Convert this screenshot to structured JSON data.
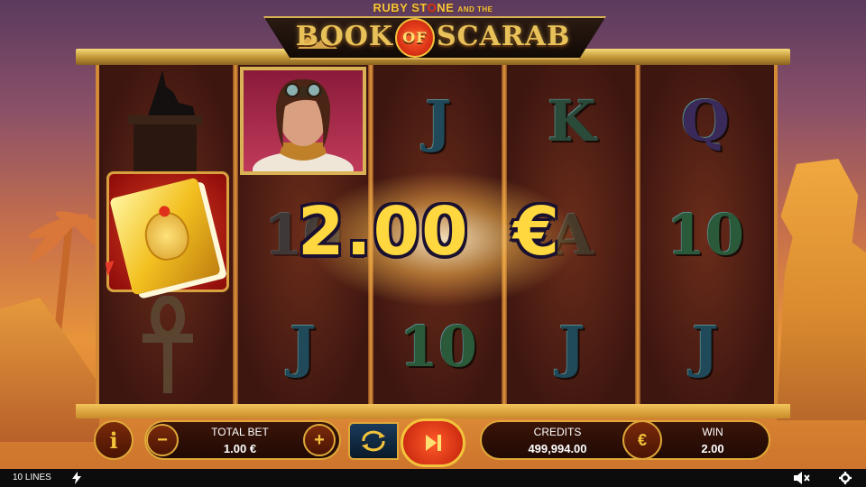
{
  "title": {
    "subtitle_ruby": "RUBY ST",
    "subtitle_o": "O",
    "subtitle_ne": "NE",
    "subtitle_andthe": "AND THE",
    "logo_book": "BOOK",
    "logo_of": "OF",
    "logo_scarab": "SCARAB"
  },
  "reels": {
    "row1": [
      "",
      "",
      "J",
      "K",
      "Q"
    ],
    "row2": [
      "",
      "10",
      "",
      "A",
      "10"
    ],
    "row3": [
      "",
      "J",
      "10",
      "J",
      "J"
    ]
  },
  "win": {
    "amount": "2.00",
    "currency": "€"
  },
  "controls": {
    "info_label": "i",
    "total_bet_label": "TOTAL BET",
    "total_bet_value": "1.00 €",
    "minus_label": "−",
    "plus_label": "+",
    "credits_label": "CREDITS",
    "credits_value": "499,994.00",
    "currency_button": "€",
    "win_label": "WIN",
    "win_value": "2.00"
  },
  "status_bar": {
    "lines": "10 LINES"
  },
  "colors": {
    "gold": "#f3c33b",
    "accent_red": "#e0301a",
    "reel_bg": "#3e1610"
  }
}
